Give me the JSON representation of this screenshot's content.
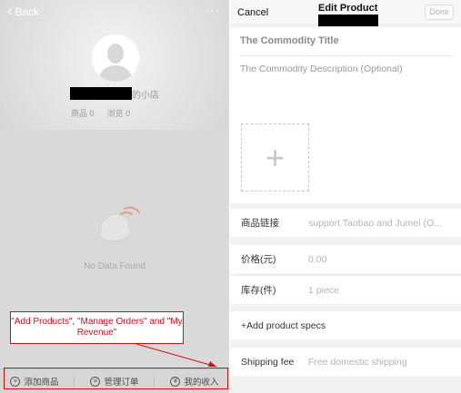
{
  "left_screen": {
    "back_label": "Back",
    "more_label": "···",
    "shop_name_suffix": "的小店",
    "stats": [
      {
        "label": "商品",
        "value": "0"
      },
      {
        "label": "浏览",
        "value": "0"
      }
    ],
    "empty_text": "No Data Found",
    "tabs": [
      {
        "label": "添加商品",
        "icon": "plus-circle-icon"
      },
      {
        "label": "管理订单",
        "icon": "list-circle-icon"
      },
      {
        "label": "我的收入",
        "icon": "yen-circle-icon"
      }
    ]
  },
  "annotation": {
    "callout_text": "\"Add Products\", \"Manage Orders\" and \"My Revenue\"",
    "color": "#cc1111"
  },
  "right_screen": {
    "cancel_label": "Cancel",
    "title": "Edit Product",
    "done_label": "Done",
    "commodity_title_placeholder": "The Commodity Title",
    "commodity_description_placeholder": "The Commodity Description (Optional)",
    "upload_icon": "plus-icon",
    "link_row": {
      "label": "商品链接",
      "placeholder": "support Taobao and Jumei (O..."
    },
    "price_row": {
      "label": "价格(元)",
      "placeholder": "0.00"
    },
    "stock_row": {
      "label": "库存(件)",
      "placeholder": "1 piece"
    },
    "specs_row": {
      "label": "+Add product specs"
    },
    "shipping_row": {
      "label": "Shipping fee",
      "placeholder": "Free domestic shipping"
    }
  }
}
